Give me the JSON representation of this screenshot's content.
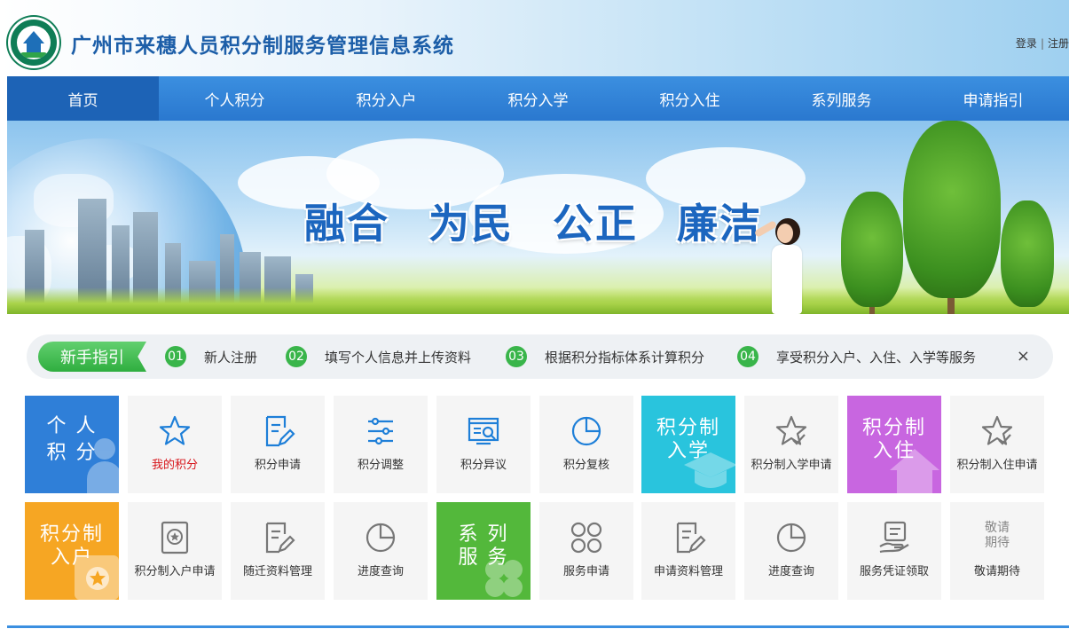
{
  "header": {
    "title": "广州市来穗人员积分制服务管理信息系统",
    "login": "登录",
    "separator": "|",
    "register": "注册"
  },
  "nav": {
    "items": [
      {
        "label": "首页"
      },
      {
        "label": "个人积分"
      },
      {
        "label": "积分入户"
      },
      {
        "label": "积分入学"
      },
      {
        "label": "积分入住"
      },
      {
        "label": "系列服务"
      },
      {
        "label": "申请指引"
      }
    ]
  },
  "banner": {
    "slogan": [
      "融合",
      "为民",
      "公正",
      "廉洁"
    ]
  },
  "guide": {
    "tag": "新手指引",
    "steps": [
      {
        "num": "01",
        "text": "新人注册"
      },
      {
        "num": "02",
        "text": "填写个人信息并上传资料"
      },
      {
        "num": "03",
        "text": "根据积分指标体系计算积分"
      },
      {
        "num": "04",
        "text": "享受积分入户、入住、入学等服务"
      }
    ],
    "close": "×"
  },
  "tiles": {
    "row1": {
      "personal_title_1": "个 人",
      "personal_title_2": "积 分",
      "my_points": "我的积分",
      "apply": "积分申请",
      "adjust": "积分调整",
      "dispute": "积分异议",
      "review": "积分复核",
      "school_title_1": "积分制",
      "school_title_2": "入学",
      "school_apply": "积分制入学申请",
      "housing_title_1": "积分制",
      "housing_title_2": "入住",
      "housing_apply": "积分制入住申请"
    },
    "row2": {
      "hukou_title_1": "积分制",
      "hukou_title_2": "入户",
      "hukou_apply": "积分制入户申请",
      "migration_docs": "随迁资料管理",
      "progress": "进度查询",
      "service_title_1": "系 列",
      "service_title_2": "服 务",
      "service_apply": "服务申请",
      "apply_docs": "申请资料管理",
      "progress_2": "进度查询",
      "certificate": "服务凭证领取",
      "coming_icon_1": "敬请",
      "coming_icon_2": "期待",
      "coming": "敬请期待"
    }
  },
  "colors": {
    "nav": "#2a78cf",
    "nav_active": "#1d63b6",
    "title": "#1c5ea8",
    "green": "#39b54a",
    "icon_blue": "#1e7fd8",
    "tile_personal": "#2f7fd8",
    "tile_school": "#29c4dd",
    "tile_housing": "#c866e0",
    "tile_hukou": "#f6a623",
    "tile_service": "#53b83b"
  }
}
